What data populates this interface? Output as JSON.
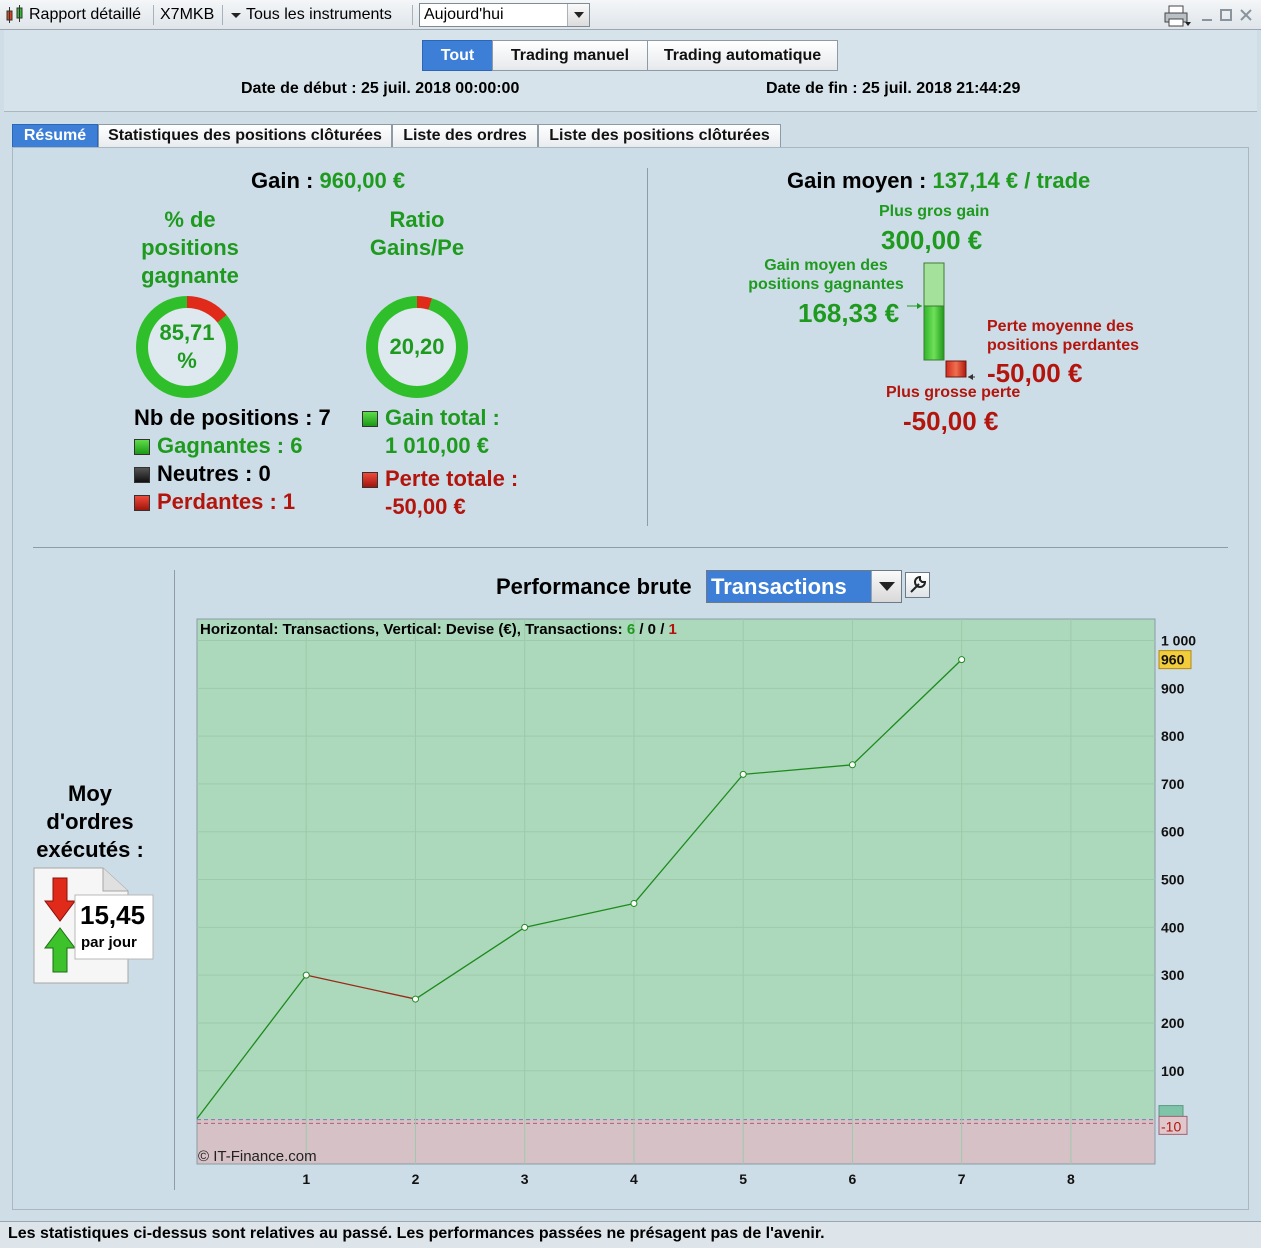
{
  "titlebar": {
    "report_label": "Rapport détaillé",
    "account": "X7MKB",
    "instruments": "Tous les instruments",
    "period": "Aujourd'hui"
  },
  "mode_buttons": [
    "Tout",
    "Trading manuel",
    "Trading automatique"
  ],
  "dates": {
    "start": "Date de début : 25 juil. 2018 00:00:00",
    "end": "Date de fin : 25 juil. 2018 21:44:29"
  },
  "tabs": [
    "Résumé",
    "Statistiques des positions clôturées",
    "Liste des ordres",
    "Liste des positions clôturées"
  ],
  "summary": {
    "gain_label": "Gain :",
    "gain_value": "960,00 €",
    "win_pct_title": [
      "% de",
      "positions",
      "gagnante"
    ],
    "win_pct_line1": "85,71",
    "win_pct_line2": "%",
    "win_pct_fraction": 0.8571,
    "ratio_title": [
      "Ratio",
      "Gains/Pe"
    ],
    "ratio_value": "20,20",
    "ratio_fraction": 0.9528,
    "positions_label": "Nb de positions : 7",
    "winners": "Gagnantes : 6",
    "neutrals": "Neutres : 0",
    "losers": "Perdantes : 1",
    "total_gain_label": "Gain total :",
    "total_gain_value": "1 010,00 €",
    "total_loss_label": "Perte totale :",
    "total_loss_value": "-50,00 €"
  },
  "average": {
    "label": "Gain moyen :",
    "value": "137,14 € / trade",
    "biggest_gain_label": "Plus gros gain",
    "biggest_gain_value": "300,00 €",
    "avg_win_label": [
      "Gain moyen des",
      "positions gagnantes"
    ],
    "avg_win_value": "168,33 €",
    "avg_loss_label": [
      "Perte moyenne des",
      "positions perdantes"
    ],
    "avg_loss_value": "-50,00 €",
    "biggest_loss_label": "Plus grosse perte",
    "biggest_loss_value": "-50,00 €"
  },
  "orders": {
    "title": [
      "Moy",
      "d'ordres",
      "exécutés :"
    ],
    "value": "15,45",
    "unit": "par jour"
  },
  "chart_header": {
    "title": "Performance brute",
    "selected": "Transactions"
  },
  "chart_data": {
    "type": "line",
    "subtitle_prefix": "Horizontal: Transactions, Vertical: Devise (€), Transactions:",
    "counts": {
      "win": "6",
      "neutral": "0",
      "loss": "1"
    },
    "x": [
      0,
      1,
      2,
      3,
      4,
      5,
      6,
      7
    ],
    "y": [
      0,
      300,
      250,
      400,
      450,
      720,
      740,
      960
    ],
    "xticks": [
      "1",
      "2",
      "3",
      "4",
      "5",
      "6",
      "7",
      "8"
    ],
    "yticks": [
      "1 000",
      "900",
      "800",
      "700",
      "600",
      "500",
      "400",
      "300",
      "200",
      "100"
    ],
    "xlim": [
      0,
      8.77
    ],
    "ylim": [
      -95,
      1045
    ],
    "last_value_label": "960",
    "lower_label": "-10",
    "watermark": "© IT-Finance.com",
    "colors": {
      "up": "#1e8a1e",
      "down": "#9a2a1a",
      "positive_area": "#acd9bb",
      "negative_area": "#d6c1c6"
    }
  },
  "footer": "Les statistiques ci-dessus sont relatives au passé. Les performances passées ne présagent pas de l'avenir."
}
